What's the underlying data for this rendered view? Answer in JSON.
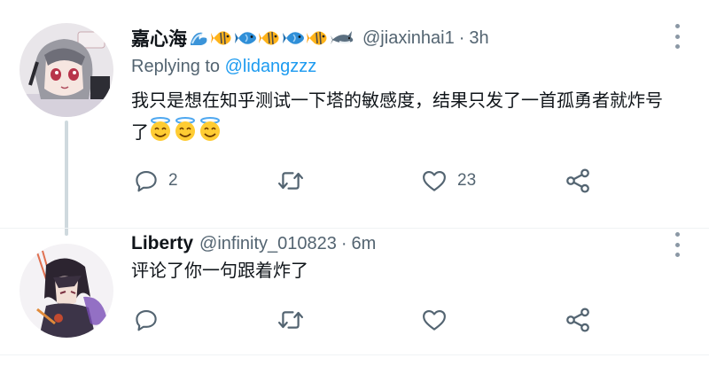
{
  "tweets": [
    {
      "display_name": "嘉心海",
      "name_emojis": [
        "wave",
        "tropical-fish",
        "fish",
        "tropical-fish",
        "fish",
        "tropical-fish",
        "shark"
      ],
      "handle": "@jiaxinhai1",
      "separator": "·",
      "time": "3h",
      "replying_to_prefix": "Replying to ",
      "replying_to_handle": "@lidangzzz",
      "text": "我只是想在知乎测试一下塔的敏感度，结果只发了一首孤勇者就炸号了",
      "trailing_emojis": [
        "smiling-face-with-halo",
        "smiling-face-with-halo",
        "smiling-face-with-halo"
      ],
      "stats": {
        "replies": "2",
        "retweets": "",
        "likes": "23"
      }
    },
    {
      "display_name": "Liberty",
      "handle": "@infinity_010823",
      "separator": "·",
      "time": "6m",
      "text": "评论了你一句跟着炸了",
      "stats": {
        "replies": "",
        "retweets": "",
        "likes": ""
      }
    }
  ],
  "colors": {
    "text": "#0f1419",
    "secondary": "#536471",
    "link": "#1d9bf0",
    "thread_line": "#cfd9de",
    "divider": "#eff3f4"
  }
}
